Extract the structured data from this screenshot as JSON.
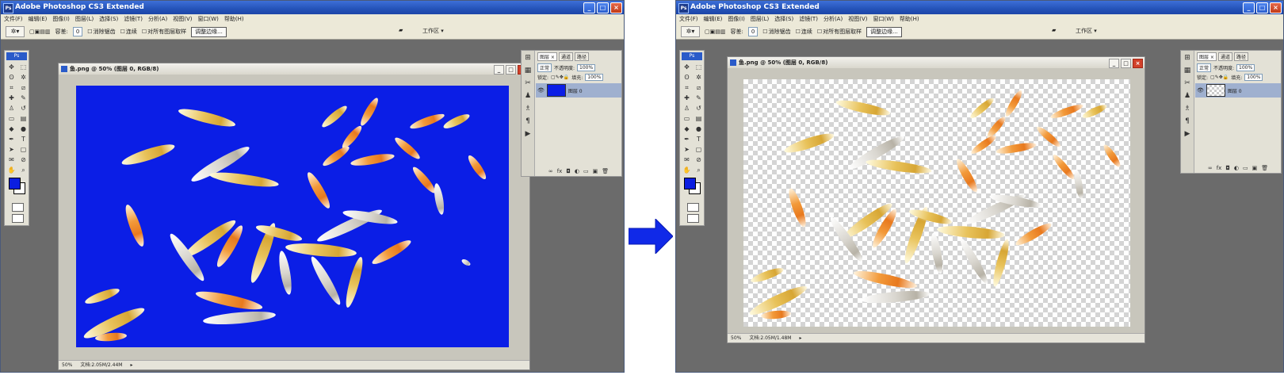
{
  "left": {
    "title": "Adobe Photoshop CS3 Extended",
    "menu": [
      "文件(F)",
      "编辑(E)",
      "图像(I)",
      "图层(L)",
      "选择(S)",
      "滤镜(T)",
      "分析(A)",
      "视图(V)",
      "窗口(W)",
      "帮助(H)"
    ],
    "options": {
      "tolerance_label": "容差:",
      "tolerance_value": "0",
      "antialias": "消除锯齿",
      "contiguous": "连续",
      "all_layers": "对所有图层取样",
      "refine_edge": "调整边缘..."
    },
    "workspace": "工作区 ▾",
    "document": {
      "title": "鱼.png @ 50% (图层 0, RGB/8)",
      "status_zoom": "50%",
      "status_doc": "文档:2.05M/2.44M"
    },
    "layers_panel": {
      "tabs": [
        "图层 ×",
        "通道",
        "路径"
      ],
      "mode": "正常",
      "opacity_label": "不透明度:",
      "opacity": "100%",
      "lock_label": "锁定:",
      "fill_label": "填充:",
      "fill": "100%",
      "layer_name": "图层 0"
    }
  },
  "right": {
    "title": "Adobe Photoshop CS3 Extended",
    "menu": [
      "文件(F)",
      "编辑(E)",
      "图像(I)",
      "图层(L)",
      "选择(S)",
      "滤镜(T)",
      "分析(A)",
      "视图(V)",
      "窗口(W)",
      "帮助(H)"
    ],
    "options": {
      "tolerance_label": "容差:",
      "tolerance_value": "0",
      "antialias": "消除锯齿",
      "contiguous": "连续",
      "all_layers": "对所有图层取样",
      "refine_edge": "调整边缘..."
    },
    "workspace": "工作区 ▾",
    "document": {
      "title": "鱼.png @ 50% (图层 0, RGB/8)",
      "status_zoom": "50%",
      "status_doc": "文档:2.05M/1.48M"
    },
    "layers_panel": {
      "tabs": [
        "图层 ×",
        "通道",
        "路径"
      ],
      "mode": "正常",
      "opacity_label": "不透明度:",
      "opacity": "100%",
      "lock_label": "锁定:",
      "fill_label": "填充:",
      "fill": "100%",
      "layer_name": "图层 0"
    }
  },
  "colors": {
    "blue_background": "#0b1ee6",
    "arrow": "#1029e8",
    "workspace_gray": "#6b6b6b"
  },
  "icons": {
    "arrow": "right-arrow-icon",
    "minimize": "minimize-icon",
    "maximize": "maximize-icon",
    "close": "close-icon"
  }
}
